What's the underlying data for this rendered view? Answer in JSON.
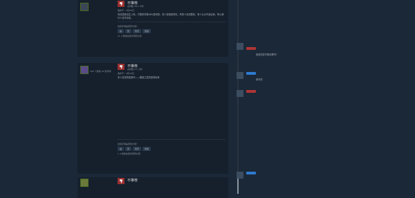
{
  "reviews": [
    {
      "user": "",
      "stats": "",
      "verdict": "不推荐",
      "hours": "总时数 28.4 小时",
      "date": "发布于：3月24日",
      "text": "你这是我出生入死，只想来享受ADV游戏的，怎么说我是来玩，有的人喜欢剧情，有人认为不适合我，所以我什么也不喜欢。",
      "helpful_q": "这篇评测是否有价值？",
      "btn_yes": "是",
      "btn_no": "否",
      "btn_funny": "欢乐",
      "btn_award": "奖励",
      "found": "11 人觉得这篇评测有价值"
    },
    {
      "user": "",
      "stats": "180 个游戏\n22 篇评测",
      "verdict": "不推荐",
      "hours": "总时数 6.3 小时",
      "date": "发布于：3月24日",
      "text": "本人支持的是原作——春音之恋的游戏玩家",
      "helpful_q": "这篇评测是否有价值？",
      "btn_yes": "是",
      "btn_no": "否",
      "btn_funny": "欢乐",
      "btn_award": "奖励",
      "found": "1 人觉得这篇评测有价值"
    },
    {
      "user": "",
      "stats": "",
      "verdict": "不推荐",
      "hours": "",
      "date": "",
      "text": "",
      "helpful_q": "",
      "btn_yes": "",
      "btn_no": "",
      "btn_funny": "",
      "btn_award": "",
      "found": ""
    }
  ],
  "comments": [
    {
      "name": "",
      "time": "",
      "body": "我说的还不够清楚吗？"
    },
    {
      "name": "",
      "time": "",
      "body": "我写的"
    },
    {
      "name": "",
      "time": "",
      "body": ""
    },
    {
      "name": "",
      "time": "",
      "body": ""
    }
  ]
}
